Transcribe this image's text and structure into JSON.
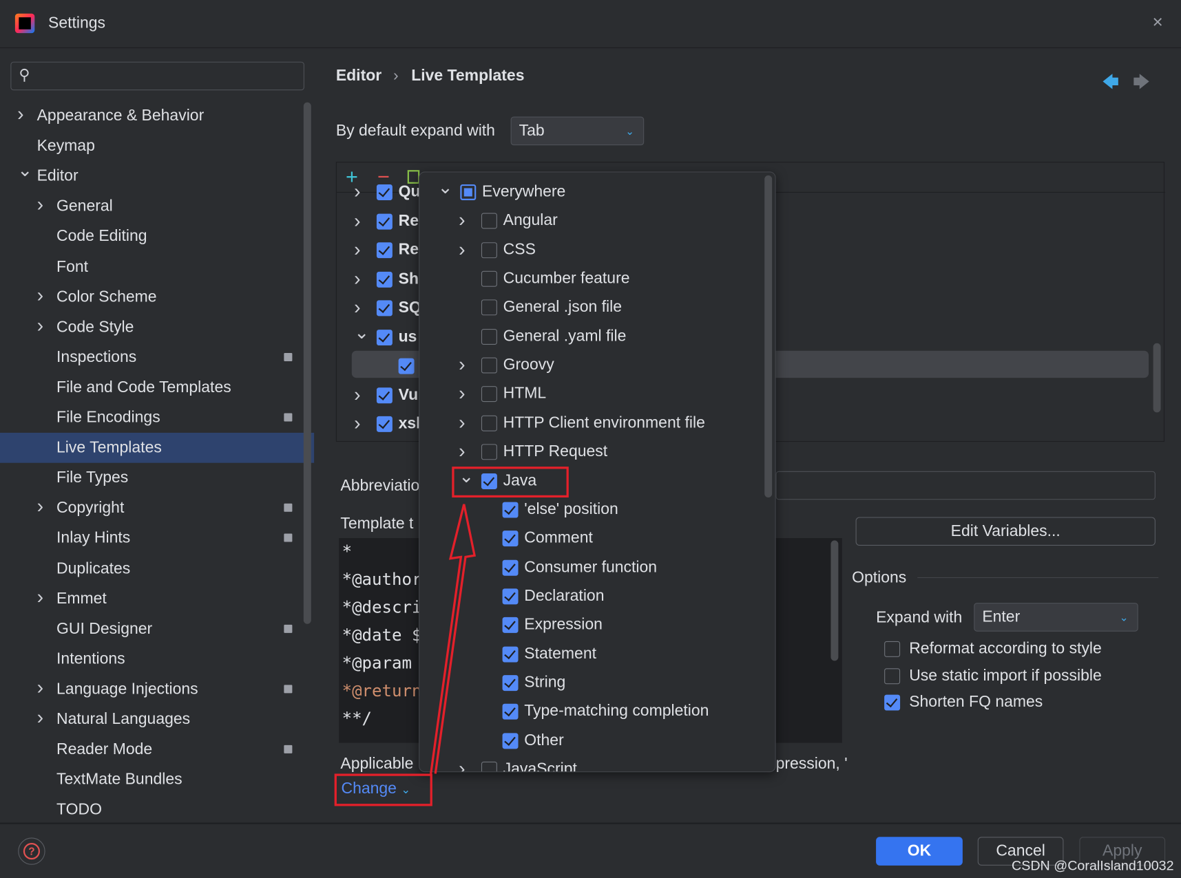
{
  "window": {
    "title": "Settings",
    "close_icon": "close-icon"
  },
  "sidebar": {
    "search_placeholder": "",
    "items": [
      {
        "label": "Appearance & Behavior",
        "level": 0,
        "chevron": "right"
      },
      {
        "label": "Keymap",
        "level": 0
      },
      {
        "label": "Editor",
        "level": 0,
        "chevron": "down"
      },
      {
        "label": "General",
        "level": 1,
        "chevron": "right"
      },
      {
        "label": "Code Editing",
        "level": 1
      },
      {
        "label": "Font",
        "level": 1
      },
      {
        "label": "Color Scheme",
        "level": 1,
        "chevron": "right"
      },
      {
        "label": "Code Style",
        "level": 1,
        "chevron": "right"
      },
      {
        "label": "Inspections",
        "level": 1,
        "badge": true
      },
      {
        "label": "File and Code Templates",
        "level": 1
      },
      {
        "label": "File Encodings",
        "level": 1,
        "badge": true
      },
      {
        "label": "Live Templates",
        "level": 1,
        "selected": true
      },
      {
        "label": "File Types",
        "level": 1
      },
      {
        "label": "Copyright",
        "level": 1,
        "chevron": "right",
        "badge": true
      },
      {
        "label": "Inlay Hints",
        "level": 1,
        "badge": true
      },
      {
        "label": "Duplicates",
        "level": 1
      },
      {
        "label": "Emmet",
        "level": 1,
        "chevron": "right"
      },
      {
        "label": "GUI Designer",
        "level": 1,
        "badge": true
      },
      {
        "label": "Intentions",
        "level": 1
      },
      {
        "label": "Language Injections",
        "level": 1,
        "chevron": "right",
        "badge": true
      },
      {
        "label": "Natural Languages",
        "level": 1,
        "chevron": "right"
      },
      {
        "label": "Reader Mode",
        "level": 1,
        "badge": true
      },
      {
        "label": "TextMate Bundles",
        "level": 1
      },
      {
        "label": "TODO",
        "level": 1
      }
    ]
  },
  "breadcrumb": {
    "parent": "Editor",
    "separator": "›",
    "current": "Live Templates"
  },
  "expand_default": {
    "label": "By default expand with",
    "value": "Tab"
  },
  "template_groups": [
    {
      "label": "Qu",
      "chevron": "right",
      "checked": true
    },
    {
      "label": "Re",
      "chevron": "right",
      "checked": true
    },
    {
      "label": "Re",
      "chevron": "right",
      "checked": true
    },
    {
      "label": "Sh",
      "chevron": "right",
      "checked": true
    },
    {
      "label": "SQ",
      "chevron": "right",
      "checked": true
    },
    {
      "label": "us",
      "chevron": "down",
      "checked": true
    },
    {
      "label": "",
      "child": true,
      "checked": true,
      "selected": true
    },
    {
      "label": "Vu",
      "chevron": "right",
      "checked": true
    },
    {
      "label": "xsl",
      "chevron": "right",
      "checked": true
    }
  ],
  "abbreviation_label": "Abbreviatio",
  "template_text_label": "Template t",
  "template_code": [
    "*",
    "*@author",
    "*@descri",
    "*@date $",
    "*@param",
    "*@return",
    "**/"
  ],
  "applicable_label": "Applicable",
  "applicable_tail": "pression, '",
  "change_link": "Change",
  "edit_variables": "Edit Variables...",
  "options": {
    "title": "Options",
    "expand_with_label": "Expand with",
    "expand_with_value": "Enter",
    "checkboxes": [
      {
        "label": "Reformat according to style",
        "checked": false
      },
      {
        "label": "Use static import if possible",
        "checked": false
      },
      {
        "label": "Shorten FQ names",
        "checked": true
      }
    ]
  },
  "context_popup": [
    {
      "label": "Everywhere",
      "level": 0,
      "chevron": "down",
      "state": "partial"
    },
    {
      "label": "Angular",
      "level": 1,
      "chevron": "right",
      "state": "off"
    },
    {
      "label": "CSS",
      "level": 1,
      "chevron": "right",
      "state": "off"
    },
    {
      "label": "Cucumber feature",
      "level": 1,
      "state": "off"
    },
    {
      "label": "General .json file",
      "level": 1,
      "state": "off"
    },
    {
      "label": "General .yaml file",
      "level": 1,
      "state": "off"
    },
    {
      "label": "Groovy",
      "level": 1,
      "chevron": "right",
      "state": "off"
    },
    {
      "label": "HTML",
      "level": 1,
      "chevron": "right",
      "state": "off"
    },
    {
      "label": "HTTP Client environment file",
      "level": 1,
      "chevron": "right",
      "state": "off"
    },
    {
      "label": "HTTP Request",
      "level": 1,
      "chevron": "right",
      "state": "off"
    },
    {
      "label": "Java",
      "level": 1,
      "chevron": "down",
      "state": "on"
    },
    {
      "label": "'else' position",
      "level": 2,
      "state": "on"
    },
    {
      "label": "Comment",
      "level": 2,
      "state": "on"
    },
    {
      "label": "Consumer function",
      "level": 2,
      "state": "on"
    },
    {
      "label": "Declaration",
      "level": 2,
      "state": "on"
    },
    {
      "label": "Expression",
      "level": 2,
      "state": "on"
    },
    {
      "label": "Statement",
      "level": 2,
      "state": "on"
    },
    {
      "label": "String",
      "level": 2,
      "state": "on"
    },
    {
      "label": "Type-matching completion",
      "level": 2,
      "state": "on"
    },
    {
      "label": "Other",
      "level": 2,
      "state": "on"
    },
    {
      "label": "JavaScript",
      "level": 1,
      "chevron": "right",
      "state": "off"
    }
  ],
  "footer": {
    "ok": "OK",
    "cancel": "Cancel",
    "apply": "Apply",
    "help_icon": "help-icon"
  },
  "watermark": "CSDN @CoralIsland10032",
  "colors": {
    "accent": "#548af7",
    "selection": "#2e436e",
    "annotation": "#e3202a",
    "ok_button": "#3574f0",
    "link": "#548af7"
  }
}
